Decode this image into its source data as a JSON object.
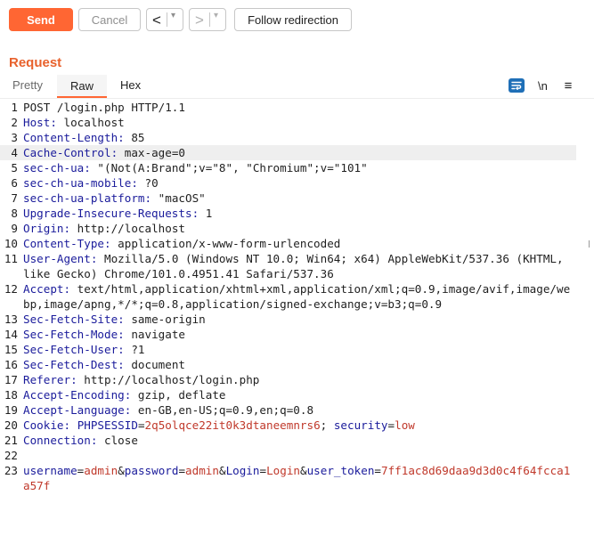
{
  "toolbar": {
    "send_label": "Send",
    "cancel_label": "Cancel",
    "back_glyph": "<",
    "forward_glyph": ">",
    "dropdown_glyph": "▾",
    "follow_label": "Follow redirection"
  },
  "request": {
    "title": "Request",
    "tabs": {
      "pretty": "Pretty",
      "raw": "Raw",
      "hex": "Hex"
    },
    "newline_toggle": "\\n",
    "menu_glyph": "≡",
    "icons": [
      "wrap-lines-icon",
      "menu-icon"
    ],
    "accent_color": "#ff6633"
  },
  "lines": [
    {
      "n": "1",
      "text": "POST /login.php HTTP/1.1"
    },
    {
      "n": "2",
      "name": "Host",
      "value": " localhost"
    },
    {
      "n": "3",
      "name": "Content-Length",
      "value": " 85"
    },
    {
      "n": "4",
      "name": "Cache-Control",
      "value": " max-age=0"
    },
    {
      "n": "5",
      "name": "sec-ch-ua",
      "value": " \"(Not(A:Brand\";v=\"8\", \"Chromium\";v=\"101\""
    },
    {
      "n": "6",
      "name": "sec-ch-ua-mobile",
      "value": " ?0"
    },
    {
      "n": "7",
      "name": "sec-ch-ua-platform",
      "value": " \"macOS\""
    },
    {
      "n": "8",
      "name": "Upgrade-Insecure-Requests",
      "value": " 1"
    },
    {
      "n": "9",
      "name": "Origin",
      "value": " http://localhost"
    },
    {
      "n": "10",
      "name": "Content-Type",
      "value": " application/x-www-form-urlencoded"
    },
    {
      "n": "11",
      "name": "User-Agent",
      "value": " Mozilla/5.0 (Windows NT 10.0; Win64; x64) AppleWebKit/537.36 (KHTML, like Gecko) Chrome/101.0.4951.41 Safari/537.36"
    },
    {
      "n": "12",
      "name": "Accept",
      "value": " text/html,application/xhtml+xml,application/xml;q=0.9,image/avif,image/webp,image/apng,*/*;q=0.8,application/signed-exchange;v=b3;q=0.9"
    },
    {
      "n": "13",
      "name": "Sec-Fetch-Site",
      "value": " same-origin"
    },
    {
      "n": "14",
      "name": "Sec-Fetch-Mode",
      "value": " navigate"
    },
    {
      "n": "15",
      "name": "Sec-Fetch-User",
      "value": " ?1"
    },
    {
      "n": "16",
      "name": "Sec-Fetch-Dest",
      "value": " document"
    },
    {
      "n": "17",
      "name": "Referer",
      "value": " http://localhost/login.php"
    },
    {
      "n": "18",
      "name": "Accept-Encoding",
      "value": " gzip, deflate"
    },
    {
      "n": "19",
      "name": "Accept-Language",
      "value": " en-GB,en-US;q=0.9,en;q=0.8"
    },
    {
      "n": "20",
      "name": "Cookie",
      "cookie": [
        {
          "k": "PHPSESSID",
          "v": "2q5olqce22it0k3dtaneemnrs6"
        },
        {
          "k": "security",
          "v": "low"
        }
      ]
    },
    {
      "n": "21",
      "name": "Connection",
      "value": " close"
    },
    {
      "n": "22",
      "text": ""
    },
    {
      "n": "23",
      "params": [
        {
          "k": "username",
          "v": "admin"
        },
        {
          "k": "password",
          "v": "admin"
        },
        {
          "k": "Login",
          "v": "Login"
        },
        {
          "k": "user_token",
          "v": "7ff1ac8d69daa9d3d0c4f64fcca1a57f"
        }
      ]
    }
  ],
  "highlighted_line": "4"
}
